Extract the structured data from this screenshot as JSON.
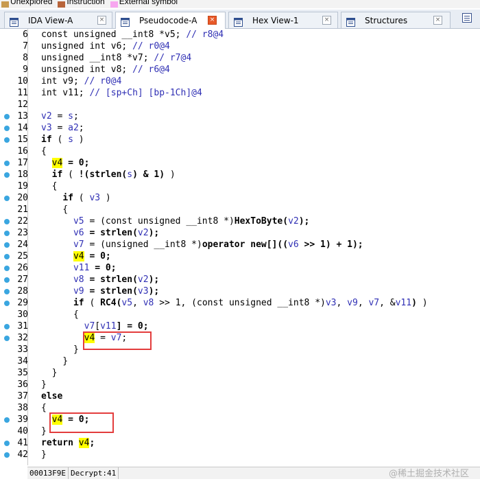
{
  "legend": [
    {
      "label": "Unexplored",
      "color": "#c89a4f"
    },
    {
      "label": "Instruction",
      "color": "#b8643a"
    },
    {
      "label": "External symbol",
      "color": "#f7a6ef"
    }
  ],
  "tabs": [
    {
      "label": "IDA View-A",
      "icon": "ida-view-icon",
      "active": false
    },
    {
      "label": "Pseudocode-A",
      "icon": "pseudocode-icon",
      "active": true
    },
    {
      "label": "Hex View-1",
      "icon": "hex-view-icon",
      "active": false
    },
    {
      "label": "Structures",
      "icon": "structures-icon",
      "active": false
    }
  ],
  "close_glyph": "×",
  "code_lines": [
    {
      "no": "6",
      "dot": false,
      "parts": [
        [
          "t",
          "const unsigned __int8 *v5; "
        ],
        [
          "cm",
          "// r8@4"
        ]
      ]
    },
    {
      "no": "7",
      "dot": false,
      "parts": [
        [
          "t",
          "unsigned int v6; "
        ],
        [
          "cm",
          "// r0@4"
        ]
      ]
    },
    {
      "no": "8",
      "dot": false,
      "parts": [
        [
          "t",
          "unsigned __int8 *v7; "
        ],
        [
          "cm",
          "// r7@4"
        ]
      ]
    },
    {
      "no": "9",
      "dot": false,
      "parts": [
        [
          "t",
          "unsigned int v8; "
        ],
        [
          "cm",
          "// r6@4"
        ]
      ]
    },
    {
      "no": "10",
      "dot": false,
      "parts": [
        [
          "t",
          "int v9; "
        ],
        [
          "cm",
          "// r0@4"
        ]
      ]
    },
    {
      "no": "11",
      "dot": false,
      "parts": [
        [
          "t",
          "int v11; "
        ],
        [
          "cm",
          "// [sp+Ch] [bp-1Ch]@4"
        ]
      ]
    },
    {
      "no": "12",
      "dot": false,
      "parts": []
    },
    {
      "no": "13",
      "dot": true,
      "parts": [
        [
          "v",
          "v2"
        ],
        [
          "t",
          " = "
        ],
        [
          "v",
          "s"
        ],
        [
          "t",
          ";"
        ]
      ]
    },
    {
      "no": "14",
      "dot": true,
      "parts": [
        [
          "v",
          "v3"
        ],
        [
          "t",
          " = "
        ],
        [
          "v",
          "a2"
        ],
        [
          "t",
          ";"
        ]
      ]
    },
    {
      "no": "15",
      "dot": true,
      "parts": [
        [
          "k",
          "if"
        ],
        [
          "t",
          " ( "
        ],
        [
          "v",
          "s"
        ],
        [
          "t",
          " )"
        ]
      ]
    },
    {
      "no": "16",
      "dot": false,
      "parts": [
        [
          "t",
          "{"
        ]
      ]
    },
    {
      "no": "17",
      "dot": true,
      "parts": [
        [
          "t",
          "  "
        ],
        [
          "hl",
          "v4"
        ],
        [
          "k",
          " = 0;"
        ]
      ]
    },
    {
      "no": "18",
      "dot": true,
      "parts": [
        [
          "t",
          "  "
        ],
        [
          "k",
          "if"
        ],
        [
          "t",
          " ( "
        ],
        [
          "k",
          "!(strlen("
        ],
        [
          "v",
          "s"
        ],
        [
          "k",
          ") & 1)"
        ],
        [
          "t",
          " )"
        ]
      ]
    },
    {
      "no": "19",
      "dot": false,
      "parts": [
        [
          "t",
          "  {"
        ]
      ]
    },
    {
      "no": "20",
      "dot": true,
      "parts": [
        [
          "t",
          "    "
        ],
        [
          "k",
          "if"
        ],
        [
          "t",
          " ( "
        ],
        [
          "v",
          "v3"
        ],
        [
          "t",
          " )"
        ]
      ]
    },
    {
      "no": "21",
      "dot": false,
      "parts": [
        [
          "t",
          "    {"
        ]
      ]
    },
    {
      "no": "22",
      "dot": true,
      "parts": [
        [
          "t",
          "      "
        ],
        [
          "v",
          "v5"
        ],
        [
          "t",
          " = (const unsigned __int8 *)"
        ],
        [
          "k",
          "HexToByte("
        ],
        [
          "v",
          "v2"
        ],
        [
          "k",
          ");"
        ]
      ]
    },
    {
      "no": "23",
      "dot": true,
      "parts": [
        [
          "t",
          "      "
        ],
        [
          "v",
          "v6"
        ],
        [
          "k",
          " = strlen("
        ],
        [
          "v",
          "v2"
        ],
        [
          "k",
          ");"
        ]
      ]
    },
    {
      "no": "24",
      "dot": true,
      "parts": [
        [
          "t",
          "      "
        ],
        [
          "v",
          "v7"
        ],
        [
          "t",
          " = (unsigned __int8 *)"
        ],
        [
          "k",
          "operator new[](("
        ],
        [
          "v",
          "v6"
        ],
        [
          "k",
          " >> 1) + 1);"
        ]
      ]
    },
    {
      "no": "25",
      "dot": true,
      "parts": [
        [
          "t",
          "      "
        ],
        [
          "hl",
          "v4"
        ],
        [
          "k",
          " = 0;"
        ]
      ]
    },
    {
      "no": "26",
      "dot": true,
      "parts": [
        [
          "t",
          "      "
        ],
        [
          "v",
          "v11"
        ],
        [
          "k",
          " = 0;"
        ]
      ]
    },
    {
      "no": "27",
      "dot": true,
      "parts": [
        [
          "t",
          "      "
        ],
        [
          "v",
          "v8"
        ],
        [
          "k",
          " = strlen("
        ],
        [
          "v",
          "v2"
        ],
        [
          "k",
          ");"
        ]
      ]
    },
    {
      "no": "28",
      "dot": true,
      "parts": [
        [
          "t",
          "      "
        ],
        [
          "v",
          "v9"
        ],
        [
          "k",
          " = strlen("
        ],
        [
          "v",
          "v3"
        ],
        [
          "k",
          ");"
        ]
      ]
    },
    {
      "no": "29",
      "dot": true,
      "parts": [
        [
          "t",
          "      "
        ],
        [
          "k",
          "if"
        ],
        [
          "t",
          " ( "
        ],
        [
          "k",
          "RC4("
        ],
        [
          "v",
          "v5"
        ],
        [
          "t",
          ", "
        ],
        [
          "v",
          "v8"
        ],
        [
          "t",
          " >> 1, (const unsigned __int8 *)"
        ],
        [
          "v",
          "v3"
        ],
        [
          "t",
          ", "
        ],
        [
          "v",
          "v9"
        ],
        [
          "t",
          ", "
        ],
        [
          "v",
          "v7"
        ],
        [
          "t",
          ", &"
        ],
        [
          "v",
          "v11"
        ],
        [
          "k",
          ")"
        ],
        [
          "t",
          " )"
        ]
      ]
    },
    {
      "no": "30",
      "dot": false,
      "parts": [
        [
          "t",
          "      {"
        ]
      ]
    },
    {
      "no": "31",
      "dot": true,
      "parts": [
        [
          "t",
          "        "
        ],
        [
          "v",
          "v7"
        ],
        [
          "t",
          "["
        ],
        [
          "v",
          "v11"
        ],
        [
          "k",
          "] = 0;"
        ]
      ]
    },
    {
      "no": "32",
      "dot": true,
      "parts": [
        [
          "t",
          "        "
        ],
        [
          "hl",
          "v4"
        ],
        [
          "t",
          " = "
        ],
        [
          "v",
          "v7"
        ],
        [
          "t",
          ";"
        ]
      ]
    },
    {
      "no": "33",
      "dot": false,
      "parts": [
        [
          "t",
          "      }"
        ]
      ]
    },
    {
      "no": "34",
      "dot": false,
      "parts": [
        [
          "t",
          "    }"
        ]
      ]
    },
    {
      "no": "35",
      "dot": false,
      "parts": [
        [
          "t",
          "  }"
        ]
      ]
    },
    {
      "no": "36",
      "dot": false,
      "parts": [
        [
          "t",
          "}"
        ]
      ]
    },
    {
      "no": "37",
      "dot": false,
      "parts": [
        [
          "k",
          "else"
        ]
      ]
    },
    {
      "no": "38",
      "dot": false,
      "parts": [
        [
          "t",
          "{"
        ]
      ]
    },
    {
      "no": "39",
      "dot": true,
      "parts": [
        [
          "t",
          "  "
        ],
        [
          "hl",
          "v4"
        ],
        [
          "k",
          " = 0;"
        ]
      ]
    },
    {
      "no": "40",
      "dot": false,
      "parts": [
        [
          "t",
          "}"
        ]
      ]
    },
    {
      "no": "41",
      "dot": true,
      "parts": [
        [
          "k",
          "return "
        ],
        [
          "hl",
          "v4"
        ],
        [
          "k",
          ";"
        ]
      ]
    },
    {
      "no": "42",
      "dot": true,
      "parts": [
        [
          "t",
          "}"
        ]
      ]
    }
  ],
  "status": {
    "address": "00013F9E",
    "function": "Decrypt:41"
  },
  "watermark": "@稀土掘金技术社区"
}
